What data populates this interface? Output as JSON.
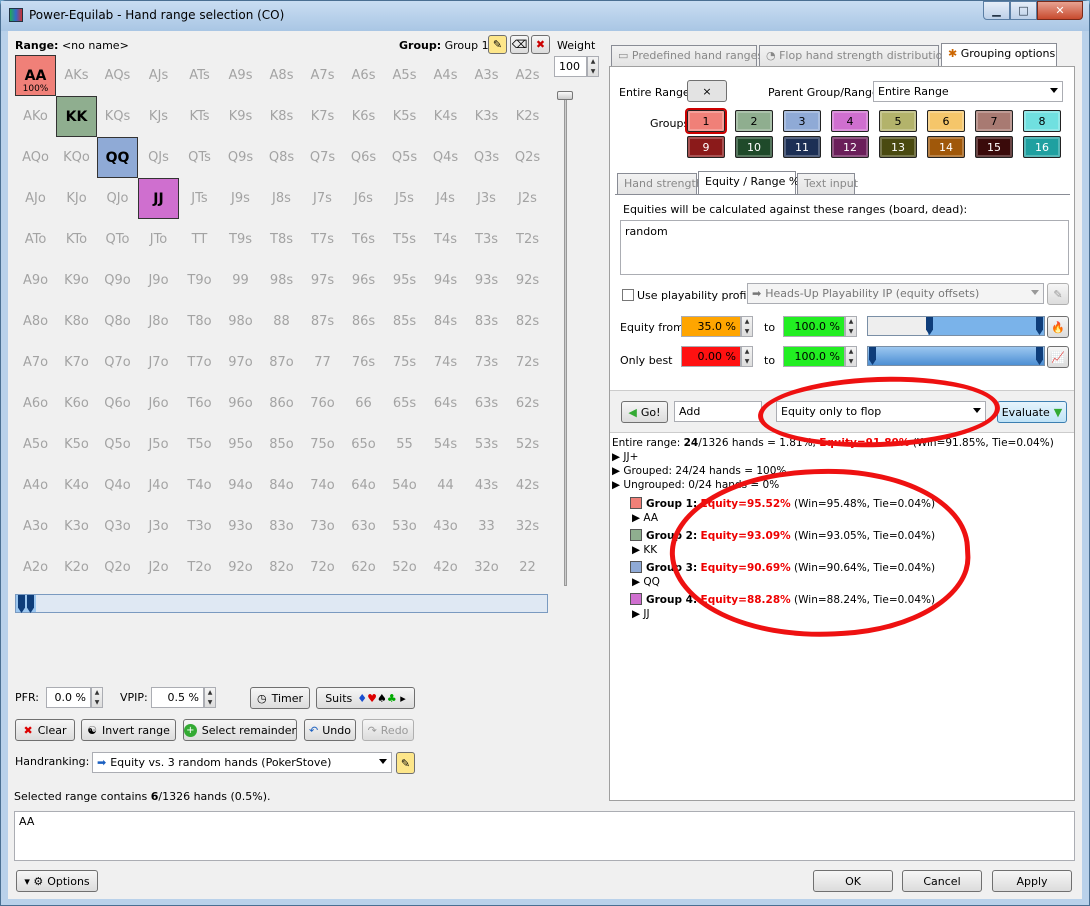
{
  "window": {
    "title": "Power-Equilab - Hand range selection (CO)"
  },
  "left": {
    "range_label": "Range:",
    "range_name": "<no name>",
    "group_label": "Group:",
    "group_value": "Group 1",
    "weight_label": "Weight",
    "weight_value": "100",
    "grid": [
      "AA",
      "AKs",
      "AQs",
      "AJs",
      "ATs",
      "A9s",
      "A8s",
      "A7s",
      "A6s",
      "A5s",
      "A4s",
      "A3s",
      "A2s",
      "AKo",
      "KK",
      "KQs",
      "KJs",
      "KTs",
      "K9s",
      "K8s",
      "K7s",
      "K6s",
      "K5s",
      "K4s",
      "K3s",
      "K2s",
      "AQo",
      "KQo",
      "QQ",
      "QJs",
      "QTs",
      "Q9s",
      "Q8s",
      "Q7s",
      "Q6s",
      "Q5s",
      "Q4s",
      "Q3s",
      "Q2s",
      "AJo",
      "KJo",
      "QJo",
      "JJ",
      "JTs",
      "J9s",
      "J8s",
      "J7s",
      "J6s",
      "J5s",
      "J4s",
      "J3s",
      "J2s",
      "ATo",
      "KTo",
      "QTo",
      "JTo",
      "TT",
      "T9s",
      "T8s",
      "T7s",
      "T6s",
      "T5s",
      "T4s",
      "T3s",
      "T2s",
      "A9o",
      "K9o",
      "Q9o",
      "J9o",
      "T9o",
      "99",
      "98s",
      "97s",
      "96s",
      "95s",
      "94s",
      "93s",
      "92s",
      "A8o",
      "K8o",
      "Q8o",
      "J8o",
      "T8o",
      "98o",
      "88",
      "87s",
      "86s",
      "85s",
      "84s",
      "83s",
      "82s",
      "A7o",
      "K7o",
      "Q7o",
      "J7o",
      "T7o",
      "97o",
      "87o",
      "77",
      "76s",
      "75s",
      "74s",
      "73s",
      "72s",
      "A6o",
      "K6o",
      "Q6o",
      "J6o",
      "T6o",
      "96o",
      "86o",
      "76o",
      "66",
      "65s",
      "64s",
      "63s",
      "62s",
      "A5o",
      "K5o",
      "Q5o",
      "J5o",
      "T5o",
      "95o",
      "85o",
      "75o",
      "65o",
      "55",
      "54s",
      "53s",
      "52s",
      "A4o",
      "K4o",
      "Q4o",
      "J4o",
      "T4o",
      "94o",
      "84o",
      "74o",
      "64o",
      "54o",
      "44",
      "43s",
      "42s",
      "A3o",
      "K3o",
      "Q3o",
      "J3o",
      "T3o",
      "93o",
      "83o",
      "73o",
      "63o",
      "53o",
      "43o",
      "33",
      "32s",
      "A2o",
      "K2o",
      "Q2o",
      "J2o",
      "T2o",
      "92o",
      "82o",
      "72o",
      "62o",
      "52o",
      "42o",
      "32o",
      "22"
    ],
    "aa_pct": "100%",
    "pfr_label": "PFR:",
    "pfr_value": "0.0 %",
    "vpip_label": "VPIP:",
    "vpip_value": "0.5 %",
    "timer": "Timer",
    "suits": "Suits",
    "clear": "Clear",
    "invert": "Invert range",
    "select_remainder": "Select remainder",
    "undo": "Undo",
    "redo": "Redo",
    "handranking_label": "Handranking:",
    "handranking_value": "Equity vs. 3 random hands (PokerStove)",
    "status_pre": "Selected range contains ",
    "status_num": "6",
    "status_post": "/1326 hands (0.5%).",
    "range_text": "AA",
    "options": "Options"
  },
  "right": {
    "tabs": [
      "Predefined hand ranges",
      "Flop hand strength distribution",
      "Grouping options"
    ],
    "entire_range_label": "Entire Range:",
    "entire_range_btn": "×",
    "parent_label": "Parent Group/Range:",
    "parent_value": "Entire Range",
    "groups_label": "Groups:",
    "groups": [
      "1",
      "2",
      "3",
      "4",
      "5",
      "6",
      "7",
      "8",
      "9",
      "10",
      "11",
      "12",
      "13",
      "14",
      "15",
      "16"
    ],
    "group_colors": [
      "#f08078",
      "#8fae8f",
      "#8faad6",
      "#cf6fcf",
      "#b3b36b",
      "#f5c66a",
      "#a87a72",
      "#70e0e0",
      "#8b1a1a",
      "#1f4a2a",
      "#1c2f55",
      "#6b1e5a",
      "#4a4a10",
      "#a0580a",
      "#3a0a0a",
      "#1fa0a0"
    ],
    "subtabs": [
      "Hand strength",
      "Equity / Range %",
      "Text input"
    ],
    "equity_desc": "Equities will be calculated against these ranges (board, dead):",
    "equity_ranges": "random",
    "playability_label": "Use playability profile:",
    "playability_value": "Heads-Up Playability IP  (equity offsets)",
    "equity_from_label": "Equity from",
    "equity_from": "35.0 %",
    "to": "to",
    "equity_to": "100.0 %",
    "only_best_label": "Only best",
    "only_best_from": "0.00 %",
    "only_best_to": "100.0 %",
    "go": "Go!",
    "add": "Add",
    "mode": "Equity only to flop",
    "evaluate": "Evaluate"
  },
  "results": {
    "l1_pre": "Entire range: ",
    "l1_hands": "24",
    "l1_mid": "/1326 hands = 1.81%, ",
    "l1_eq": "Equity=91.89%",
    "l1_post": " (Win=91.85%, Tie=0.04%)",
    "l2": "JJ+",
    "l3": "Grouped: 24/24 hands = 100%",
    "l4": "Ungrouped: 0/24 hands = 0%",
    "groups": [
      {
        "name": "Group 1:",
        "eq": "Equity=95.52%",
        "rest": "(Win=95.48%, Tie=0.04%)",
        "hand": "AA"
      },
      {
        "name": "Group 2:",
        "eq": "Equity=93.09%",
        "rest": "(Win=93.05%, Tie=0.04%)",
        "hand": "KK"
      },
      {
        "name": "Group 3:",
        "eq": "Equity=90.69%",
        "rest": "(Win=90.64%, Tie=0.04%)",
        "hand": "QQ"
      },
      {
        "name": "Group 4:",
        "eq": "Equity=88.28%",
        "rest": "(Win=88.24%, Tie=0.04%)",
        "hand": "JJ"
      }
    ]
  },
  "footer": {
    "ok": "OK",
    "cancel": "Cancel",
    "apply": "Apply"
  }
}
